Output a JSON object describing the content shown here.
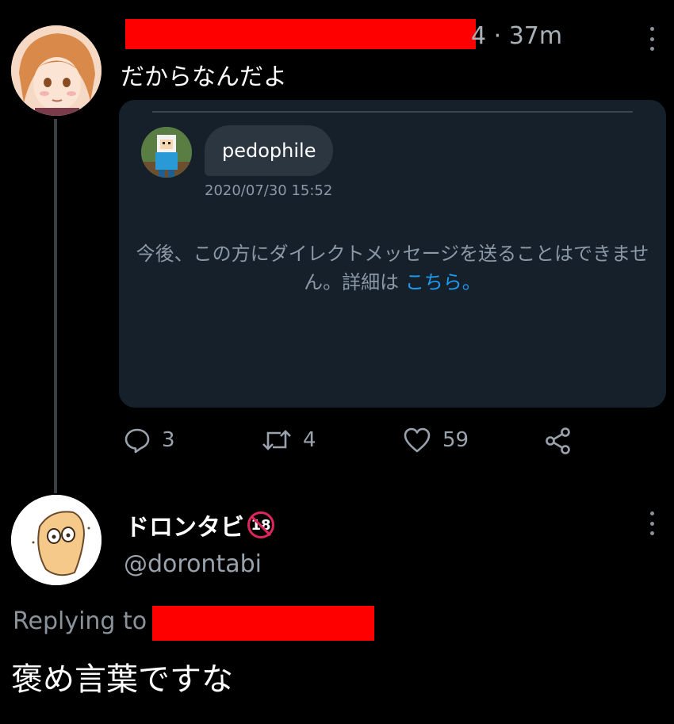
{
  "tweet1": {
    "time": "4 · 37m",
    "text": "だからなんだよ",
    "embedded_dm": {
      "message": "pedophile",
      "timestamp": "2020/07/30 15:52",
      "notice": "今後、この方にダイレクトメッセージを送ることはできません。詳細は",
      "notice_link": "こちら。"
    },
    "actions": {
      "replies": "3",
      "retweets": "4",
      "likes": "59"
    }
  },
  "tweet2": {
    "display_name": "ドロンタビ",
    "age_badge": "18",
    "handle": "@dorontabi",
    "replying_to_label": "Replying to",
    "text": "褒め言葉ですな"
  },
  "colors": {
    "background": "#000000",
    "card": "#15202b",
    "link": "#1d9bf0",
    "redaction": "#ff0000",
    "muted": "#9aa3ad"
  }
}
